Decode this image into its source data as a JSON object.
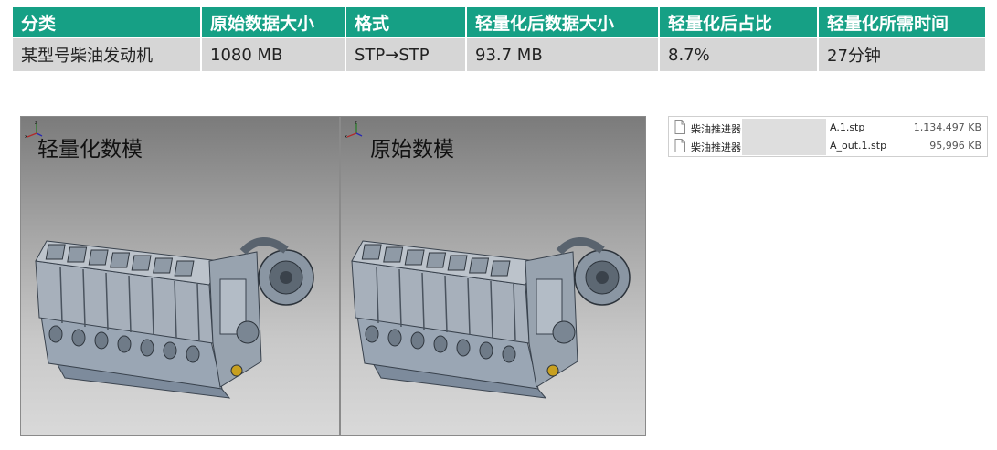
{
  "table": {
    "headers": [
      "分类",
      "原始数据大小",
      "格式",
      "轻量化后数据大小",
      "轻量化后占比",
      "轻量化所需时间"
    ],
    "row": [
      "某型号柴油发动机",
      "1080 MB",
      "STP→STP",
      "93.7 MB",
      "8.7%",
      "27分钟"
    ]
  },
  "viewports": {
    "left_label": "轻量化数模",
    "right_label": "原始数模"
  },
  "files": [
    {
      "name": "柴油推进器",
      "ext": "A.1.stp",
      "size": "1,134,497 KB"
    },
    {
      "name": "柴油推进器",
      "ext": "A_out.1.stp",
      "size": "95,996 KB"
    }
  ],
  "colors": {
    "header_bg": "#16a085",
    "row_bg": "#d6d6d6"
  }
}
